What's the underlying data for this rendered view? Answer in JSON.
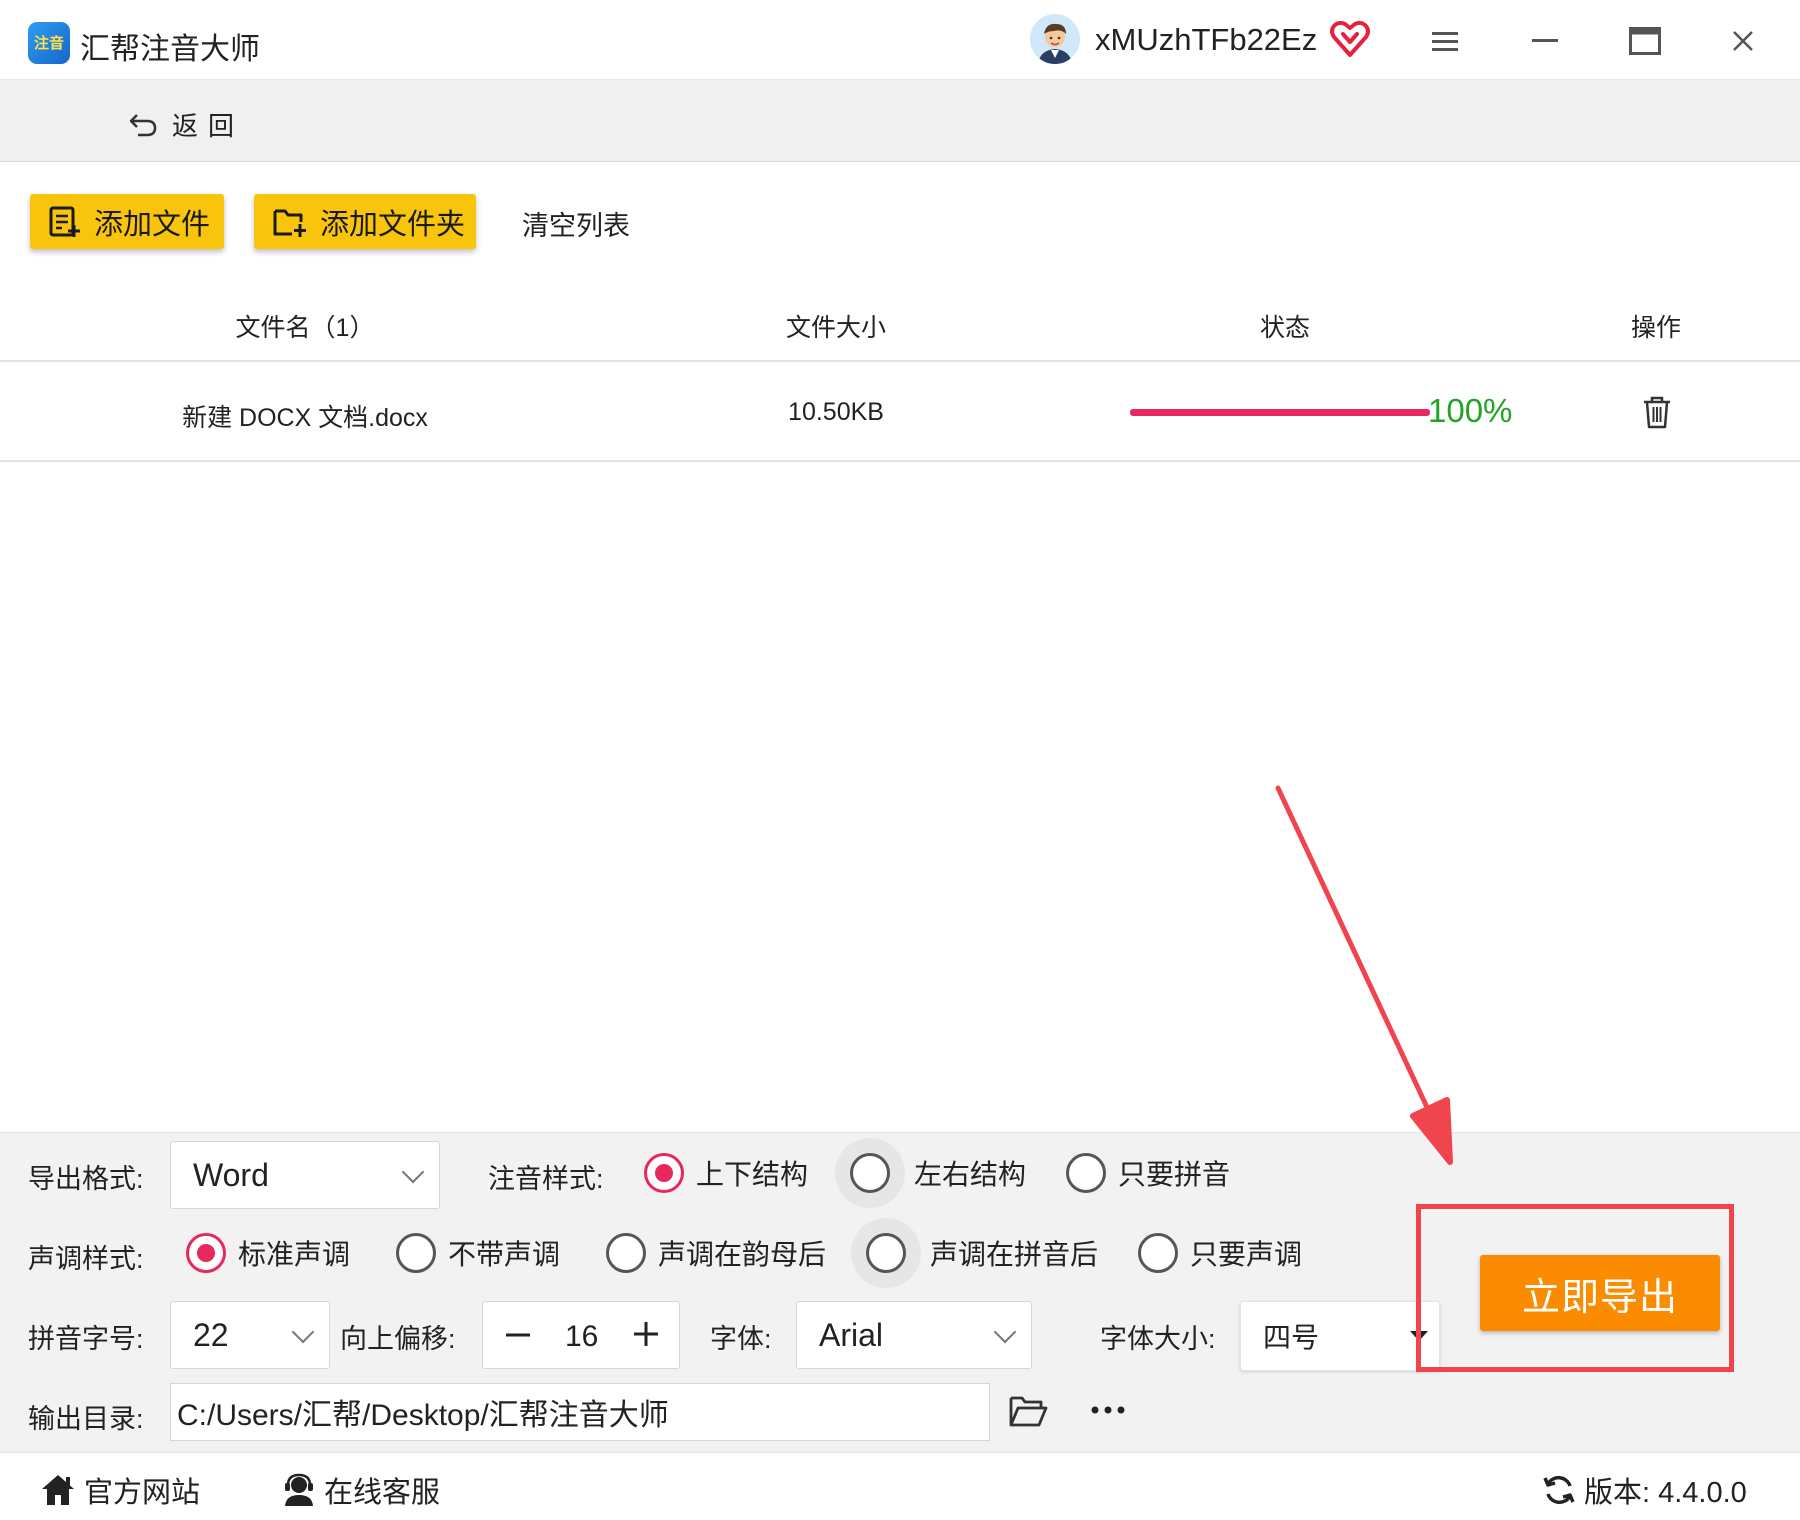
{
  "window": {
    "app_title": "汇帮注音大师",
    "logo_text": "注音",
    "username": "xMUzhTFb22Ez"
  },
  "nav": {
    "back_label": "返回"
  },
  "toolbar": {
    "add_file_label": "添加文件",
    "add_folder_label": "添加文件夹",
    "clear_list_label": "清空列表"
  },
  "table": {
    "columns": [
      "文件名（1）",
      "文件大小",
      "状态",
      "操作"
    ],
    "rows": [
      {
        "name": "新建 DOCX 文档.docx",
        "size": "10.50KB",
        "progress": 100,
        "progress_label": "100%"
      }
    ]
  },
  "settings": {
    "export_format": {
      "label": "导出格式:",
      "value": "Word"
    },
    "annotation_style": {
      "label": "注音样式:",
      "options": [
        "上下结构",
        "左右结构",
        "只要拼音"
      ],
      "selected": 0
    },
    "tone_style": {
      "label": "声调样式:",
      "options": [
        "标准声调",
        "不带声调",
        "声调在韵母后",
        "声调在拼音后",
        "只要声调"
      ],
      "selected": 0
    },
    "pinyin_size": {
      "label": "拼音字号:",
      "value": "22"
    },
    "offset_up": {
      "label": "向上偏移:",
      "value": "16"
    },
    "font": {
      "label": "字体:",
      "value": "Arial"
    },
    "font_size": {
      "label": "字体大小:",
      "value": "四号"
    },
    "output_dir": {
      "label": "输出目录:",
      "value": "C:/Users/汇帮/Desktop/汇帮注音大师"
    },
    "export_button_label": "立即导出"
  },
  "footer": {
    "official_site_label": "官方网站",
    "online_service_label": "在线客服",
    "version_label": "版本:  4.4.0.0"
  },
  "colors": {
    "accent_yellow": "#f9c40c",
    "export_orange": "#fb8c00",
    "radio_selected": "#e8275d",
    "progress_done": "#24a324",
    "annotation_red": "#f0454f"
  },
  "icons": {
    "vip": "heart-diamond-icon",
    "menu": "hamburger-icon",
    "back": "undo-arrow-icon",
    "delete": "trash-icon",
    "folder": "folder-open-icon",
    "more": "ellipsis-icon",
    "home": "home-icon",
    "service": "user-support-icon",
    "version": "refresh-icon"
  }
}
